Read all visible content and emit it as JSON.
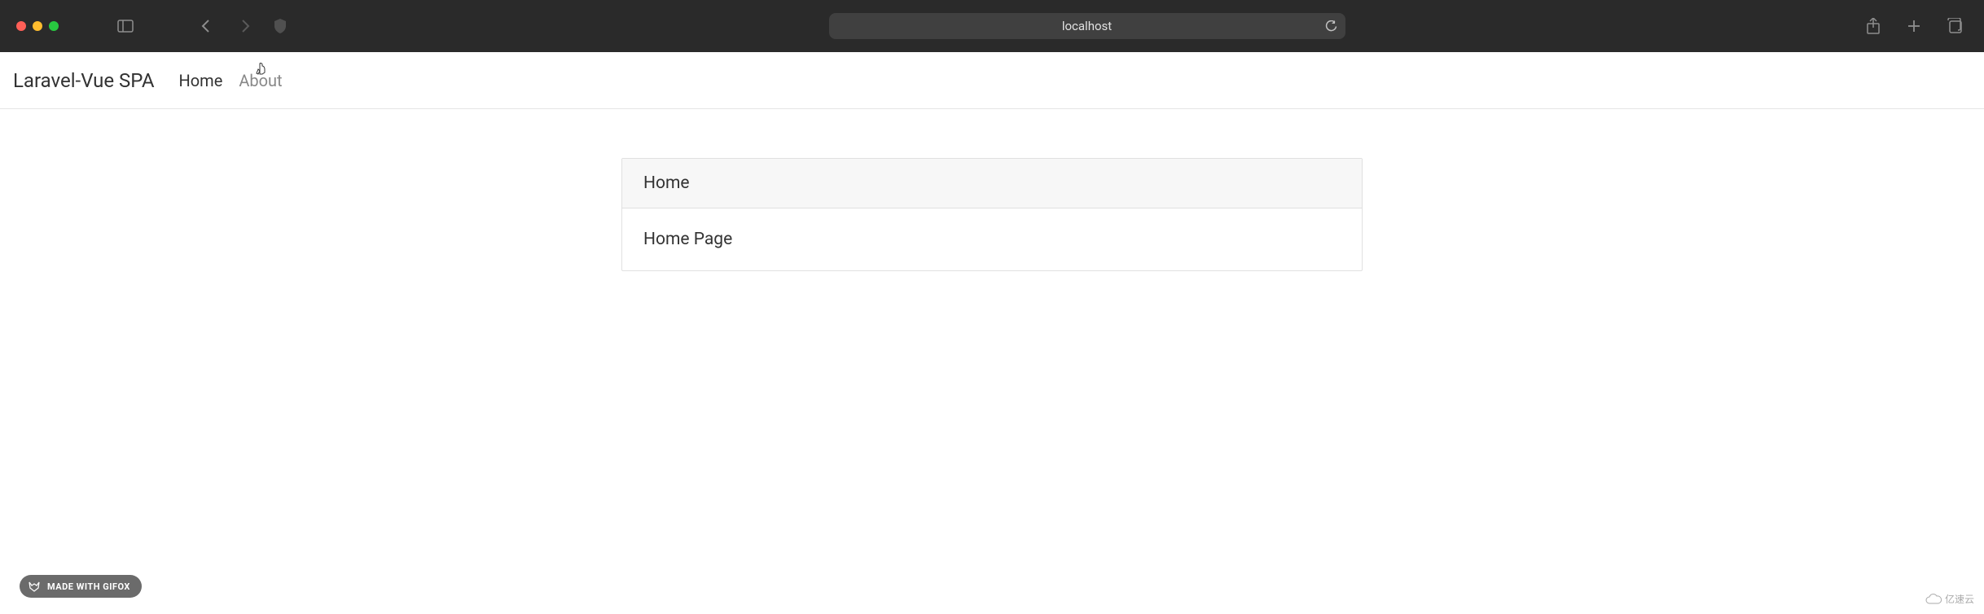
{
  "browser": {
    "url": "localhost"
  },
  "navbar": {
    "brand": "Laravel-Vue SPA",
    "links": [
      {
        "label": "Home"
      },
      {
        "label": "About"
      }
    ]
  },
  "card": {
    "title": "Home",
    "body": "Home Page"
  },
  "badge": {
    "text": "MADE WITH GIFOX"
  },
  "watermark": {
    "text": "亿速云"
  }
}
